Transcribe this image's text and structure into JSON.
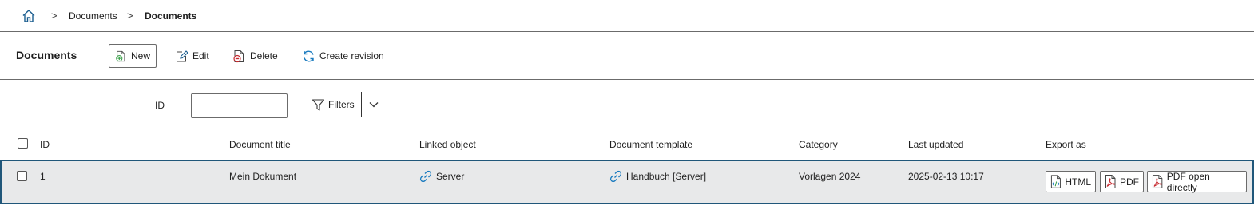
{
  "breadcrumb": {
    "home_icon": "home-icon",
    "separator": ">",
    "items": [
      "Documents",
      "Documents"
    ]
  },
  "toolbar": {
    "title": "Documents",
    "buttons": [
      {
        "label": "New",
        "icon": "add-document-icon"
      },
      {
        "label": "Edit",
        "icon": "edit-icon"
      },
      {
        "label": "Delete",
        "icon": "delete-document-icon"
      },
      {
        "label": "Create revision",
        "icon": "refresh-icon"
      }
    ]
  },
  "filter": {
    "id_label": "ID",
    "id_value": "",
    "filters_label": "Filters"
  },
  "table": {
    "columns": [
      "ID",
      "Document title",
      "Linked object",
      "Document template",
      "Category",
      "Last updated",
      "Export as"
    ],
    "rows": [
      {
        "id": "1",
        "title": "Mein Dokument",
        "linked_object": "Server",
        "template": "Handbuch [Server]",
        "category": "Vorlagen 2024",
        "last_updated": "2025-02-13 10:17",
        "exports": [
          "HTML",
          "PDF",
          "PDF open directly"
        ]
      }
    ]
  },
  "colors": {
    "accent_blue": "#1a7bbf",
    "pdf_red": "#c6282e",
    "add_green": "#2e9a3e",
    "row_selected_bg": "#e8e9ea",
    "row_selected_border": "#20577a"
  }
}
